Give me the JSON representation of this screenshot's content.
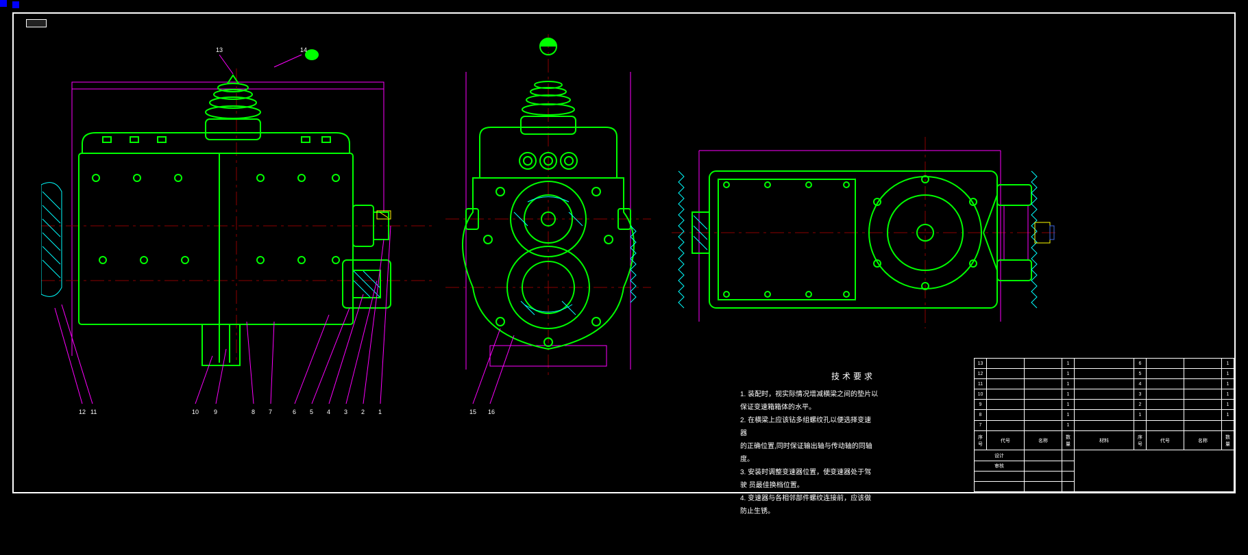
{
  "notes": {
    "title": "技术要求",
    "items": [
      "1. 装配时，视实际情况增减横梁之间的垫片以",
      "   保证变速箱箱体的水平。",
      "2. 在横梁上应该钻多组螺纹孔以便选择变速",
      "   器",
      "   的正确位置,同时保证输出轴与传动轴的同轴",
      "   度。",
      "3. 安装时调整变速器位置，使变速器处于驾",
      "   驶     员最佳换档位置。",
      "4. 变速器与各相邻部件螺纹连接前，应该做",
      "   防止生锈。"
    ]
  },
  "leaders": {
    "top": [
      "13",
      "14"
    ],
    "bottom_left": [
      "12",
      "11",
      "10",
      "9",
      "8",
      "7",
      "6",
      "5",
      "4",
      "3",
      "2",
      "1"
    ],
    "bottom_mid": [
      "15",
      "16"
    ]
  },
  "titleblock": {
    "rows": [
      [
        "13",
        "",
        "1",
        "",
        "",
        "6",
        "",
        "1",
        ""
      ],
      [
        "12",
        "",
        "1",
        "",
        "",
        "5",
        "",
        "1",
        ""
      ],
      [
        "11",
        "",
        "1",
        "",
        "",
        "4",
        "",
        "1",
        ""
      ],
      [
        "10",
        "",
        "1",
        "",
        "",
        "3",
        "",
        "1",
        ""
      ],
      [
        "9",
        "",
        "1",
        "",
        "",
        "2",
        "",
        "1",
        ""
      ],
      [
        "8",
        "",
        "1",
        "",
        "",
        "1",
        "",
        "1",
        ""
      ],
      [
        "7",
        "",
        "1",
        "",
        "",
        "",
        "",
        "",
        ""
      ]
    ],
    "header": [
      "序号",
      "代号",
      "名称",
      "数量",
      "材料",
      "序号",
      "代号",
      "名称",
      "数量"
    ],
    "footer_rows": [
      [
        "",
        "",
        "",
        "",
        "",
        "",
        "",
        ""
      ],
      [
        "设计",
        "",
        "",
        "",
        "",
        "",
        "",
        ""
      ],
      [
        "审核",
        "",
        "",
        "",
        "",
        "",
        "",
        ""
      ],
      [
        "",
        "",
        "",
        "",
        "",
        "",
        "",
        ""
      ]
    ]
  },
  "colors": {
    "part": "#00FF00",
    "dim": "#FF00FF",
    "center": "#8B0000",
    "hatch": "#00FFFF",
    "detail": "#FFFF00"
  }
}
